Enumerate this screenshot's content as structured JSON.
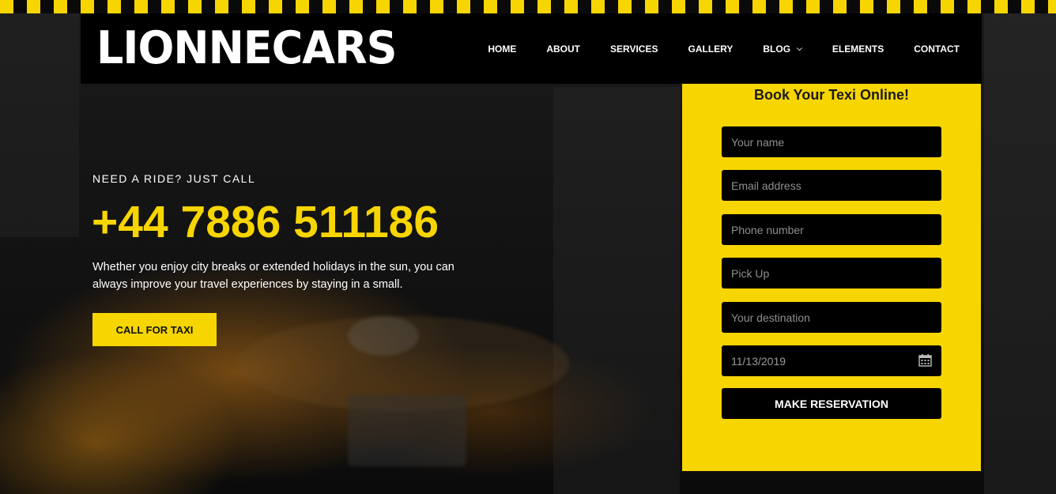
{
  "brand": {
    "logo_text": "LIONNECARS"
  },
  "nav": {
    "items": [
      {
        "label": "HOME"
      },
      {
        "label": "ABOUT"
      },
      {
        "label": "SERVICES"
      },
      {
        "label": "GALLERY"
      },
      {
        "label": "BLOG",
        "has_dropdown": true
      },
      {
        "label": "ELEMENTS"
      },
      {
        "label": "CONTACT"
      }
    ]
  },
  "hero": {
    "kicker": "NEED A RIDE? JUST CALL",
    "phone": "+44 7886 511186",
    "description": "Whether you enjoy city breaks or extended holidays in the sun, you can always improve your travel experiences by staying in a small.",
    "cta_label": "CALL FOR TAXI"
  },
  "booking": {
    "title": "Book Your Texi Online!",
    "fields": {
      "name_placeholder": "Your name",
      "email_placeholder": "Email address",
      "phone_placeholder": "Phone number",
      "pickup_placeholder": "Pick Up",
      "destination_placeholder": "Your destination",
      "date_value": "11/13/2019"
    },
    "submit_label": "MAKE RESERVATION"
  },
  "icons": {
    "calendar": "calendar-icon",
    "dropdown": "chevron-down-icon"
  },
  "colors": {
    "accent": "#f7d500",
    "dark": "#000000",
    "text_light": "#ffffff"
  }
}
